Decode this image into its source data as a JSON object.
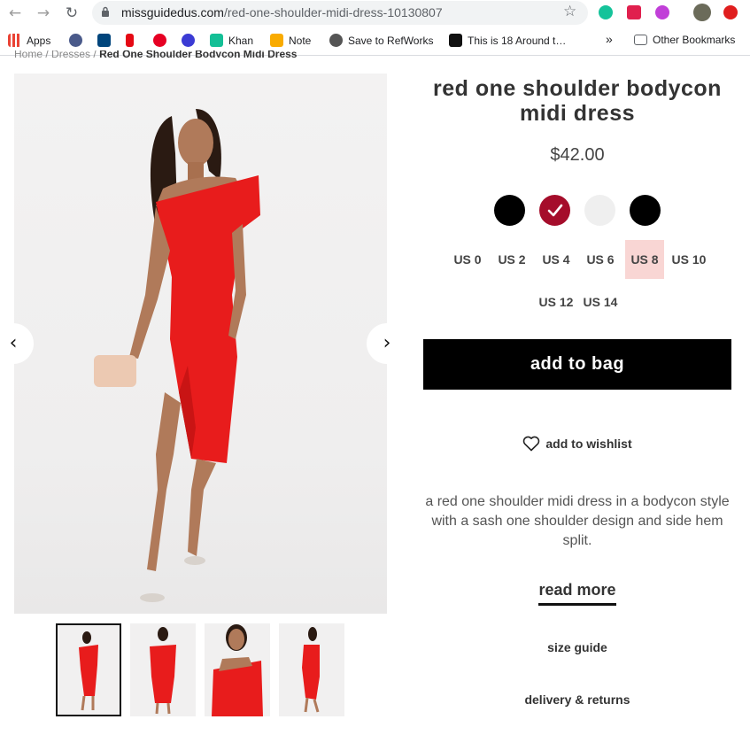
{
  "browser": {
    "url_domain": "missguidedus.com",
    "url_path": "/red-one-shoulder-midi-dress-10130807",
    "bookmarks": [
      {
        "label": "Apps",
        "color": "#ea4335"
      },
      {
        "label": "",
        "color": "#4a5a8a"
      },
      {
        "label": "",
        "color": "#00457c"
      },
      {
        "label": "",
        "color": "#e50914"
      },
      {
        "label": "",
        "color": "#e60023"
      },
      {
        "label": "",
        "color": "#3b3bd4"
      },
      {
        "label": "Khan",
        "color": "#14bf96"
      },
      {
        "label": "Note",
        "color": "#f9ab00"
      },
      {
        "label": "Save to RefWorks",
        "color": "#555555"
      },
      {
        "label": "This is 18 Around t…",
        "color": "#111111"
      }
    ],
    "overflow": "»",
    "other_bookmarks": "Other Bookmarks"
  },
  "breadcrumb": {
    "home": "Home",
    "sep": "/",
    "category": "Dresses",
    "current": "Red One Shoulder Bodycon Midi Dress"
  },
  "gallery": {
    "prev": "‹",
    "next": "›",
    "thumb_count": 4
  },
  "product": {
    "title": "red one shoulder bodycon midi dress",
    "price": "$42.00",
    "colors": [
      "#000000",
      "#a50d2b",
      "#efefef",
      "#000000"
    ],
    "selected_color_index": 1,
    "sizes_row1": [
      "US 0",
      "US 2",
      "US 4",
      "US 6",
      "US 8",
      "US 10"
    ],
    "sizes_row2": [
      "US 12",
      "US 14"
    ],
    "selected_size": "US 8",
    "add_to_bag": "add to bag",
    "wishlist": "add to wishlist",
    "description": "a red one shoulder midi dress in a bodycon style with a sash one shoulder design and side hem split.",
    "read_more": "read more",
    "size_guide": "size guide",
    "delivery": "delivery & returns"
  }
}
